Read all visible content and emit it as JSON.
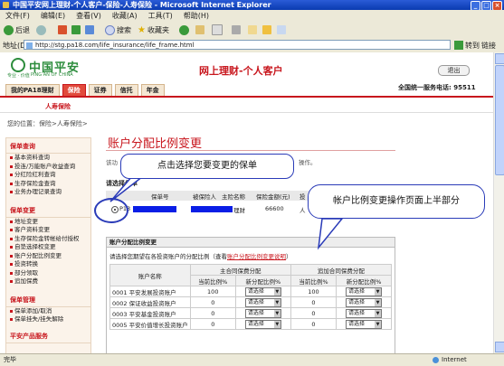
{
  "window": {
    "title": "中国平安网上理财-个人客户-保险-人寿保险 - Microsoft Internet Explorer"
  },
  "menu": [
    "文件(F)",
    "编辑(E)",
    "查看(V)",
    "收藏(A)",
    "工具(T)",
    "帮助(H)"
  ],
  "toolbar": {
    "back": "后退",
    "search": "搜索",
    "favorites": "收藏夹"
  },
  "address": {
    "label": "地址(D)",
    "url": "http://stg.pa18.com/life_insurance/life_frame.html",
    "go": "转到",
    "links": "链接"
  },
  "header": {
    "logo": "中国平安",
    "logo_sub": "PING AN OF CHINA",
    "logo_sub_left": "专业 · 价值",
    "title": "网上理财-个人客户",
    "exit": "退出",
    "hotline": "全国统一服务电话: 95511"
  },
  "nav": {
    "tabs": [
      "我的PA18理财",
      "保险",
      "证券",
      "信托",
      "年金"
    ],
    "subnav": "人寿保险"
  },
  "breadcrumb": "您的位置：保险>人寿保险>",
  "sidebar": {
    "sections": [
      {
        "title": "保单查询",
        "items": [
          "基本资料查询",
          "投连/万能账户收益查询",
          "分红险红利查询",
          "生存保险金查询",
          "业务办理记录查询"
        ]
      },
      {
        "title": "保单变更",
        "items": [
          "地址变更",
          "客户资料变更",
          "生存保险金转帐给付授权",
          "自垫选择权变更",
          "账户分配比例变更",
          "投资转换",
          "部分领取",
          "追加保费"
        ]
      },
      {
        "title": "保单管理",
        "items": [
          "保单添加/取消",
          "保单挂失/挂失解除"
        ]
      },
      {
        "title": "平安产品服务",
        "items": []
      }
    ]
  },
  "main": {
    "title": "账户分配比例变更",
    "intro": "该功",
    "intro_right": "操作。",
    "select_label": "请选择保单",
    "policy_headers": [
      "保单号",
      "被保险人",
      "主险名称",
      "保险金额(元)",
      "投"
    ],
    "policy_row": {
      "radio": "P13",
      "product": "理财",
      "amount": "66600",
      "tail": "人"
    },
    "section2": {
      "title": "账户分配比例变更",
      "desc": "请选择您期望在各投资账户的分配比例（查看",
      "desc_link": "账户分配比例变更说明",
      "desc_end": "）",
      "col_account": "账户名称",
      "group_main": "主合同保费分配",
      "group_add": "追加合同保费分配",
      "col_current": "当前比例%",
      "col_new": "新分配比例%",
      "rows": [
        {
          "name": "0001 平安发展投资账户",
          "main_current": "100",
          "main_new": "请选择",
          "add_current": "100",
          "add_new": "请选择"
        },
        {
          "name": "0002 保证收益投资账户",
          "main_current": "0",
          "main_new": "请选择",
          "add_current": "0",
          "add_new": "请选择"
        },
        {
          "name": "0003 平安基金投资账户",
          "main_current": "0",
          "main_new": "请选择",
          "add_current": "0",
          "add_new": "请选择"
        },
        {
          "name": "0005 平安价值增长投资账户",
          "main_current": "0",
          "main_new": "请选择",
          "add_current": "0",
          "add_new": "请选择"
        }
      ]
    }
  },
  "callouts": {
    "select_policy": "点击选择您要变更的保单",
    "upper_half": "帐户比例变更操作页面上半部分"
  },
  "status": {
    "left": "完毕",
    "zone": "Internet"
  }
}
